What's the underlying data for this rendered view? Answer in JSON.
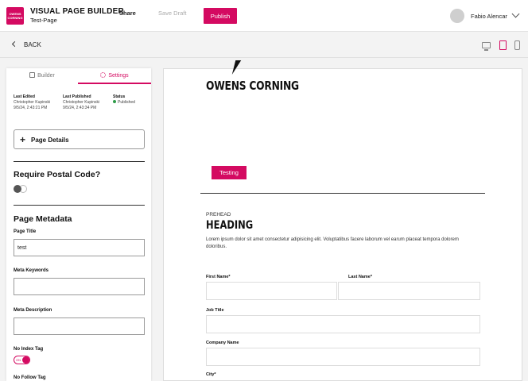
{
  "header": {
    "logo_text": "OWENS CORNING",
    "app_title": "VISUAL PAGE BUILDER",
    "page_name": "Test-Page",
    "share_label": "Share",
    "save_draft_label": "Save Draft",
    "publish_label": "Publish",
    "user_name": "Fabio Alencar"
  },
  "subbar": {
    "back_label": "BACK"
  },
  "panel": {
    "tabs": [
      {
        "label": "Builder"
      },
      {
        "label": "Settings"
      }
    ],
    "meta": {
      "last_edited_label": "Last Edited",
      "last_edited_by": "Christopher Kupinski",
      "last_edited_date": "9/5/24, 2:43:21 PM",
      "last_published_label": "Last Published",
      "last_published_by": "Christopher Kupinski",
      "last_published_date": "9/5/24, 2:43:34 PM",
      "status_label": "Status",
      "status_value": "Published"
    },
    "page_details_label": "Page Details",
    "postal_heading": "Require Postal Code?",
    "metadata_heading": "Page Metadata",
    "page_title_label": "Page Title",
    "page_title_value": "test",
    "meta_keywords_label": "Meta Keywords",
    "meta_keywords_value": "",
    "meta_description_label": "Meta Description",
    "meta_description_value": "",
    "no_index_label": "No Index Tag",
    "no_index_toggle_text": "ON",
    "no_follow_label": "No Follow Tag"
  },
  "canvas": {
    "brand": "OWENS CORNING",
    "testing_button": "Testing",
    "prehead": "PREHEAD",
    "heading": "HEADING",
    "body": "Lorem ipsum dolor sit amet consectetur adipisicing elit. Voluptatibus facere laborum vel earum placeat tempora dolorem doloribus.",
    "form": {
      "first_name_label": "First Name*",
      "last_name_label": "Last Name*",
      "job_title_label": "Job Title",
      "company_label": "Company Name",
      "city_label": "City*"
    }
  },
  "colors": {
    "accent": "#d40a61",
    "status_published": "#2e9b48"
  }
}
